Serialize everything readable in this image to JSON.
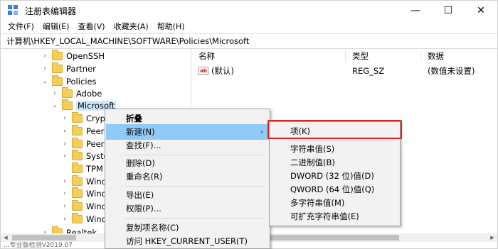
{
  "app": {
    "title": "注册表编辑器"
  },
  "window_controls": {
    "minimize": "—",
    "maximize": "☐",
    "close": "✕"
  },
  "menubar": [
    "文件(F)",
    "编辑(E)",
    "查看(V)",
    "收藏夹(A)",
    "帮助(H)"
  ],
  "address": "计算机\\HKEY_LOCAL_MACHINE\\SOFTWARE\\Policies\\Microsoft",
  "tree": {
    "items": [
      {
        "label": "OpenSSH",
        "chevron": "›"
      },
      {
        "label": "Partner",
        "chevron": "›"
      },
      {
        "label": "Policies",
        "chevron": "⌄"
      },
      {
        "label": "Adobe",
        "chevron": "›"
      },
      {
        "label": "Microsoft",
        "chevron": "⌄"
      },
      {
        "label": "Crypt",
        "chevron": "›"
      },
      {
        "label": "PeerD",
        "chevron": "›"
      },
      {
        "label": "Peern",
        "chevron": "›"
      },
      {
        "label": "Syster",
        "chevron": "›"
      },
      {
        "label": "TPM",
        "chevron": ""
      },
      {
        "label": "Windo",
        "chevron": "›"
      },
      {
        "label": "Windo",
        "chevron": "›"
      },
      {
        "label": "Windo",
        "chevron": "›"
      },
      {
        "label": "Windo",
        "chevron": "›"
      },
      {
        "label": "Realtek",
        "chevron": "›"
      }
    ]
  },
  "list": {
    "headers": {
      "name": "名称",
      "type": "类型",
      "data": "数据"
    },
    "rows": [
      {
        "icon": "ab",
        "name": "(默认)",
        "type": "REG_SZ",
        "data": "(数值未设置)"
      }
    ]
  },
  "context_menu": {
    "items": [
      "折叠",
      "新建(N)",
      "查找(F)...",
      "删除(D)",
      "重命名(R)",
      "导出(E)",
      "权限(P)...",
      "复制项名称(C)",
      "访问 HKEY_CURRENT_USER(T)"
    ],
    "arrow": "›"
  },
  "submenu": {
    "items": [
      "项(K)",
      "字符串值(S)",
      "二进制值(B)",
      "DWORD (32 位)值(D)",
      "QWORD (64 位)值(Q)",
      "多字符串值(M)",
      "可扩充字符串值(E)"
    ]
  },
  "status_text": "...专业版检测V2019.07",
  "colors": {
    "highlight_box": "#e02020",
    "hover": "#91c9f7",
    "selected": "#cce8ff",
    "folder": "#f5cd5b"
  }
}
